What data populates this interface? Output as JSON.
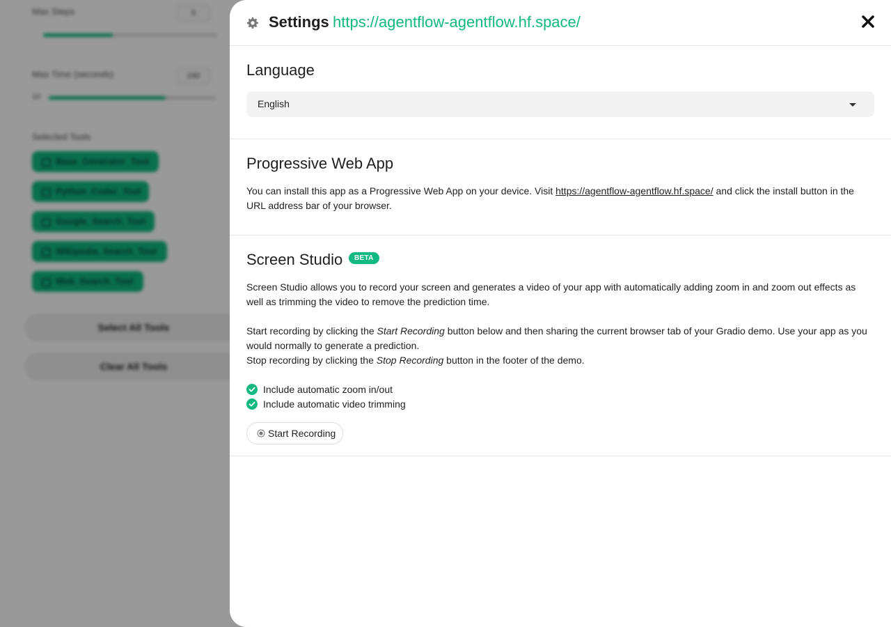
{
  "background": {
    "max_steps_label": "Max Steps",
    "max_steps_value": "5",
    "max_time_label": "Max Time (seconds)",
    "max_time_value": "240",
    "max_time_min": "10",
    "max_steps_fill": 0.4,
    "max_time_fill": 0.7,
    "selected_tools_label": "Selected Tools",
    "tools": [
      "Base_Generator_Tool",
      "Python_Coder_Tool",
      "Google_Search_Tool",
      "Wikipedia_Search_Tool",
      "Web_Search_Tool"
    ],
    "select_all": "Select All Tools",
    "clear_all": "Clear All Tools"
  },
  "settings": {
    "title": "Settings",
    "url": "https://agentflow-agentflow.hf.space/",
    "language": {
      "title": "Language",
      "selected": "English"
    },
    "pwa": {
      "title": "Progressive Web App",
      "text_before": "You can install this app as a Progressive Web App on your device. Visit ",
      "link": "https://agentflow-agentflow.hf.space/",
      "text_after": " and click the install button in the URL address bar of your browser."
    },
    "studio": {
      "title": "Screen Studio",
      "badge": "BETA",
      "p1": "Screen Studio allows you to record your screen and generates a video of your app with automatically adding zoom in and zoom out effects as well as trimming the video to remove the prediction time.",
      "p2_before": "Start recording by clicking the ",
      "p2_em": "Start Recording",
      "p2_after": " button below and then sharing the current browser tab of your Gradio demo. Use your app as you would normally to generate a prediction.",
      "p3_before": "Stop recording by clicking the ",
      "p3_em": "Stop Recording",
      "p3_after": " button in the footer of the demo.",
      "check_zoom": "Include automatic zoom in/out",
      "check_trim": "Include automatic video trimming",
      "record_button": "Start Recording"
    }
  },
  "colors": {
    "accent": "#10b981",
    "overlay": "rgba(0,0,0,0.4)"
  },
  "icons": {
    "settings": "gear-icon",
    "close": "close-icon",
    "checkbox": "check-circle-icon",
    "record": "record-icon",
    "dropdown": "caret-down-icon"
  }
}
